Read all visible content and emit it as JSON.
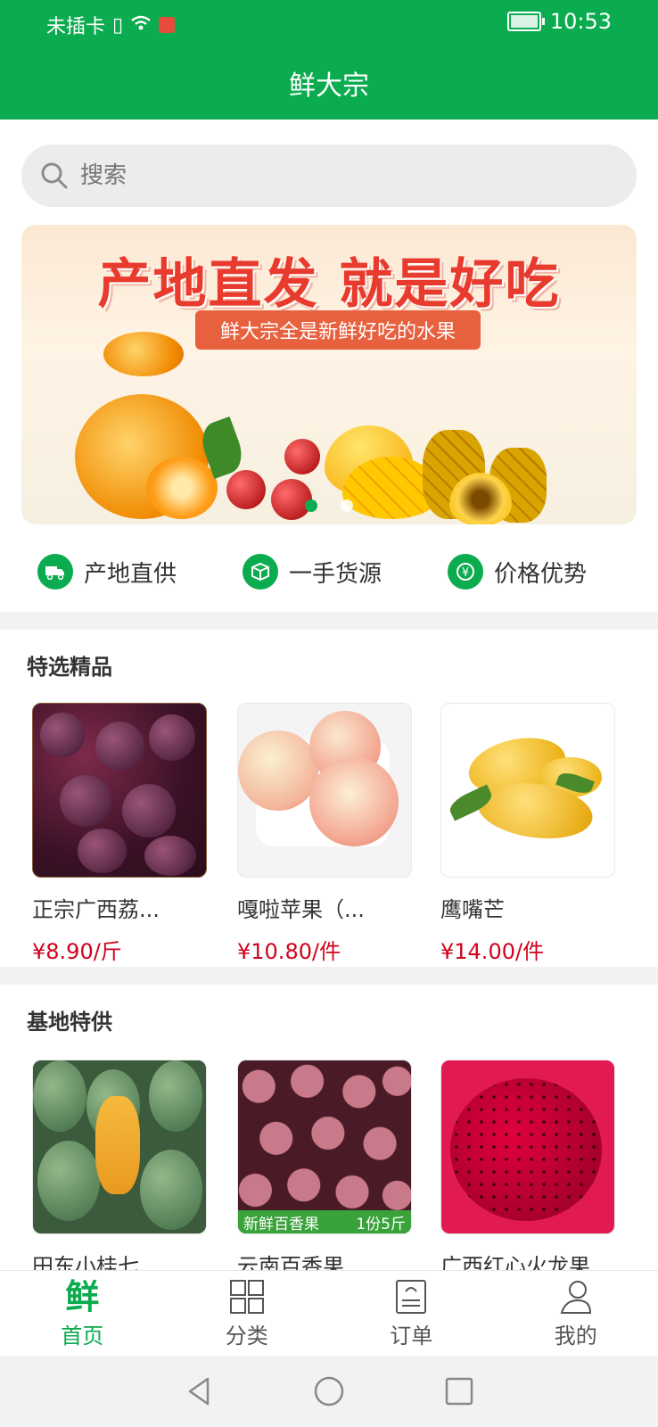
{
  "status": {
    "carrier": "未插卡",
    "time": "10:53"
  },
  "header": {
    "title": "鲜大宗"
  },
  "search": {
    "placeholder": "搜索"
  },
  "banner": {
    "title": "产地直发 就是好吃",
    "subtitle": "鲜大宗全是新鲜好吃的水果",
    "slide_count": 2,
    "active_slide": 0
  },
  "features": [
    {
      "label": "产地直供",
      "icon": "truck-icon"
    },
    {
      "label": "一手货源",
      "icon": "box-icon"
    },
    {
      "label": "价格优势",
      "icon": "yuan-icon"
    }
  ],
  "sections": [
    {
      "title": "特选精品",
      "products": [
        {
          "name": "正宗广西荔...",
          "price": "¥8.90/斤",
          "image": "passion-fruit-basket"
        },
        {
          "name": "嘎啦苹果（...",
          "price": "¥10.80/件",
          "image": "peaches"
        },
        {
          "name": "鹰嘴芒",
          "price": "¥14.00/件",
          "image": "mangoes"
        }
      ]
    },
    {
      "title": "基地特供",
      "products": [
        {
          "name": "田东小桂七...",
          "image": "green-mangoes"
        },
        {
          "name": "云南百香果",
          "image": "passion-fruit-pile",
          "badge_left": "新鲜百香果",
          "badge_right": "1份5斤"
        },
        {
          "name": "广西红心火龙果",
          "image": "red-dragon-fruit"
        }
      ]
    }
  ],
  "tabbar": [
    {
      "label": "首页",
      "icon": "home-xian-icon",
      "glyph": "鲜",
      "active": true
    },
    {
      "label": "分类",
      "icon": "grid-icon",
      "active": false
    },
    {
      "label": "订单",
      "icon": "order-icon",
      "active": false
    },
    {
      "label": "我的",
      "icon": "user-icon",
      "active": false
    }
  ],
  "colors": {
    "brand": "#0bab4f",
    "price": "#d0021b"
  }
}
